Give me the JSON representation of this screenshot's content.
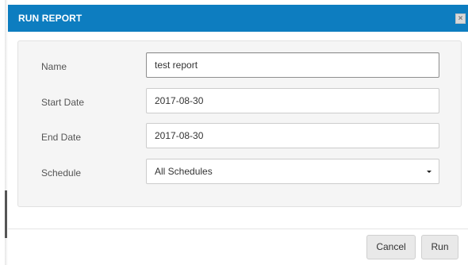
{
  "dialog": {
    "title": "RUN REPORT",
    "close_glyph": "×",
    "close_icon": "close-icon"
  },
  "form": {
    "name": {
      "label": "Name",
      "value": "test report"
    },
    "start_date": {
      "label": "Start Date",
      "value": "2017-08-30"
    },
    "end_date": {
      "label": "End Date",
      "value": "2017-08-30"
    },
    "schedule": {
      "label": "Schedule",
      "value": "All Schedules",
      "icon": "caret-down-icon"
    }
  },
  "footer": {
    "cancel_label": "Cancel",
    "run_label": "Run"
  },
  "colors": {
    "header": "#0d7dc0",
    "panel": "#f5f5f5",
    "button": "#e9e9e9"
  }
}
